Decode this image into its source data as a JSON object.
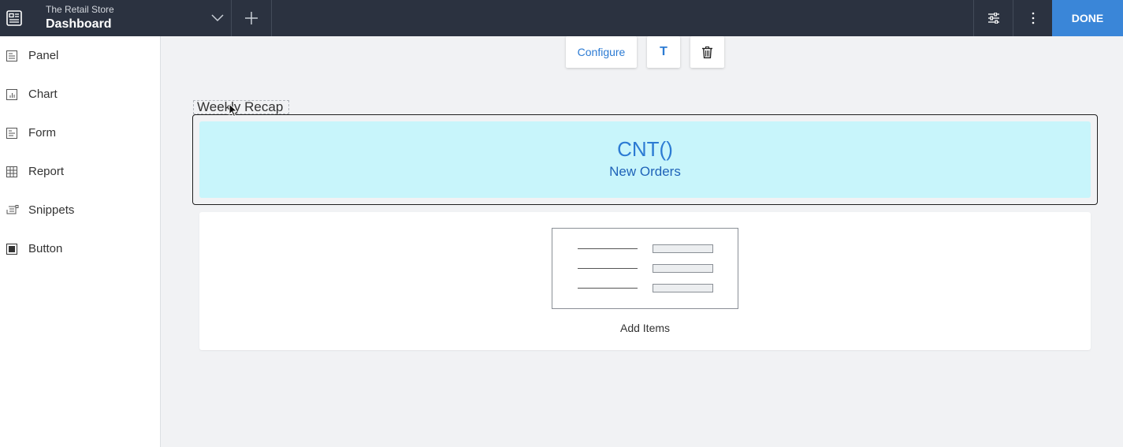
{
  "header": {
    "app_name": "The Retail Store",
    "page_name": "Dashboard",
    "done_label": "DONE"
  },
  "sidebar": {
    "items": [
      {
        "label": "Panel",
        "icon": "panel-icon"
      },
      {
        "label": "Chart",
        "icon": "chart-icon"
      },
      {
        "label": "Form",
        "icon": "form-icon"
      },
      {
        "label": "Report",
        "icon": "report-icon"
      },
      {
        "label": "Snippets",
        "icon": "snippets-icon"
      },
      {
        "label": "Button",
        "icon": "button-icon"
      }
    ]
  },
  "toolbar": {
    "configure_label": "Configure",
    "text_label": "T"
  },
  "canvas": {
    "panel_title": "Weekly Recap",
    "kpi_value": "CNT()",
    "kpi_label": "New Orders",
    "add_items_label": "Add Items"
  },
  "colors": {
    "topbar": "#2b3240",
    "accent": "#3a86d8",
    "kpi_bg": "#c8f5fb",
    "kpi_text": "#2c7bd3"
  }
}
